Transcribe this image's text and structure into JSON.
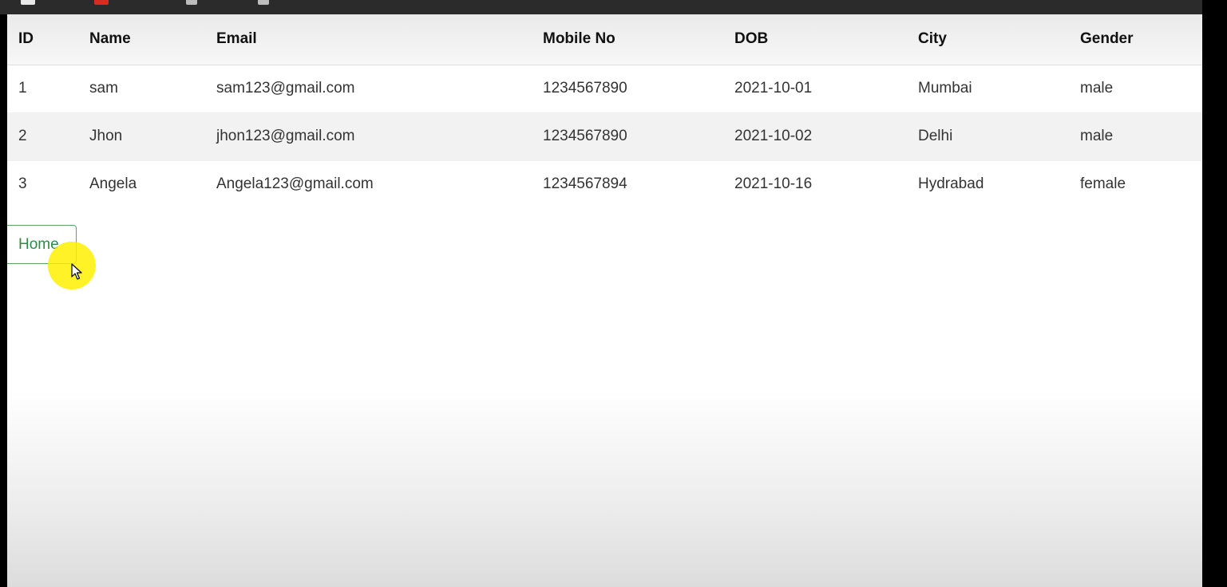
{
  "table": {
    "headers": [
      "ID",
      "Name",
      "Email",
      "Mobile No",
      "DOB",
      "City",
      "Gender"
    ],
    "rows": [
      [
        "1",
        "sam",
        "sam123@gmail.com",
        "1234567890",
        "2021-10-01",
        "Mumbai",
        "male"
      ],
      [
        "2",
        "Jhon",
        "jhon123@gmail.com",
        "1234567890",
        "2021-10-02",
        "Delhi",
        "male"
      ],
      [
        "3",
        "Angela",
        "Angela123@gmail.com",
        "1234567894",
        "2021-10-16",
        "Hydrabad",
        "female"
      ]
    ]
  },
  "home_button": {
    "label": "Home"
  },
  "colors": {
    "button_text": "#2e8b47",
    "button_border": "#5aa36a",
    "cursor_highlight": "#fff000",
    "top_bar": "#2b2b2b"
  },
  "icons": {
    "cursor": "cursor-arrow-icon"
  }
}
